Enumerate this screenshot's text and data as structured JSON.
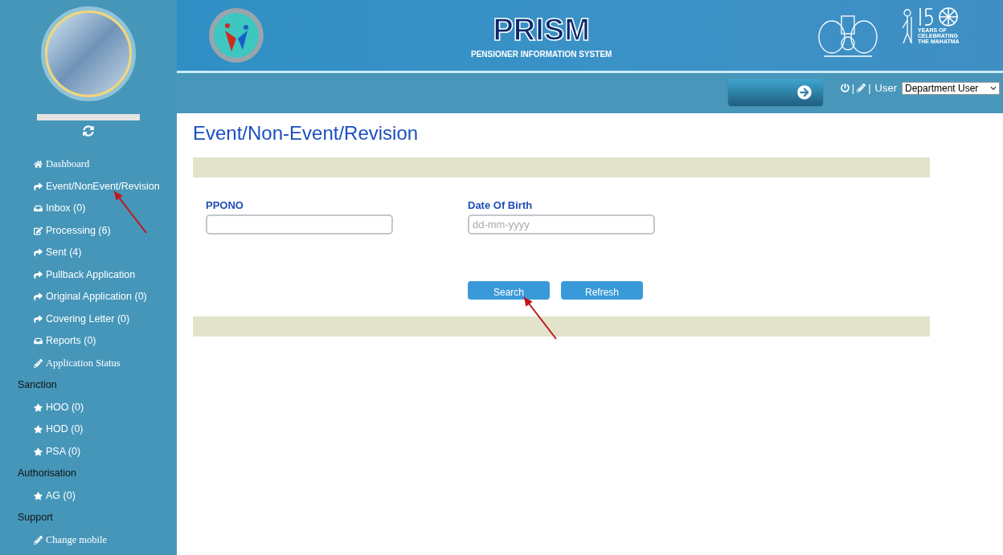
{
  "header": {
    "title": "PRISM",
    "subtitle": "PENSIONER INFORMATION SYSTEM",
    "anniversary_caption": [
      "YEARS OF",
      "CELEBRATING",
      "THE MAHATMA"
    ]
  },
  "toolbar": {
    "separators": [
      "|",
      "|"
    ],
    "user_label": "User",
    "user_select": "Department User"
  },
  "sidebar": {
    "links": [
      {
        "label": "Dashboard"
      },
      {
        "label": "Event/NonEvent/Revision"
      },
      {
        "label": "Inbox (0)"
      },
      {
        "label": "Processing (6)"
      },
      {
        "label": "Sent (4)"
      },
      {
        "label": "Pullback Application"
      },
      {
        "label": "Original Application (0)"
      },
      {
        "label": "Covering Letter (0)"
      },
      {
        "label": "Reports (0)"
      },
      {
        "label": "Application Status"
      }
    ],
    "sections": [
      {
        "title": "Sanction",
        "items": [
          {
            "label": "HOO (0)"
          },
          {
            "label": "HOD (0)"
          },
          {
            "label": "PSA (0)"
          }
        ]
      },
      {
        "title": "Authorisation",
        "items": [
          {
            "label": "AG (0)"
          }
        ]
      },
      {
        "title": "Support",
        "items": [
          {
            "label": "Change mobile"
          }
        ]
      }
    ]
  },
  "page": {
    "title": "Event/Non-Event/Revision",
    "fields": [
      {
        "label": "PPONO"
      },
      {
        "label": "Date Of Birth",
        "placeholder": "dd-mm-yyyy"
      }
    ],
    "buttons": [
      "Search",
      "Refresh"
    ]
  }
}
